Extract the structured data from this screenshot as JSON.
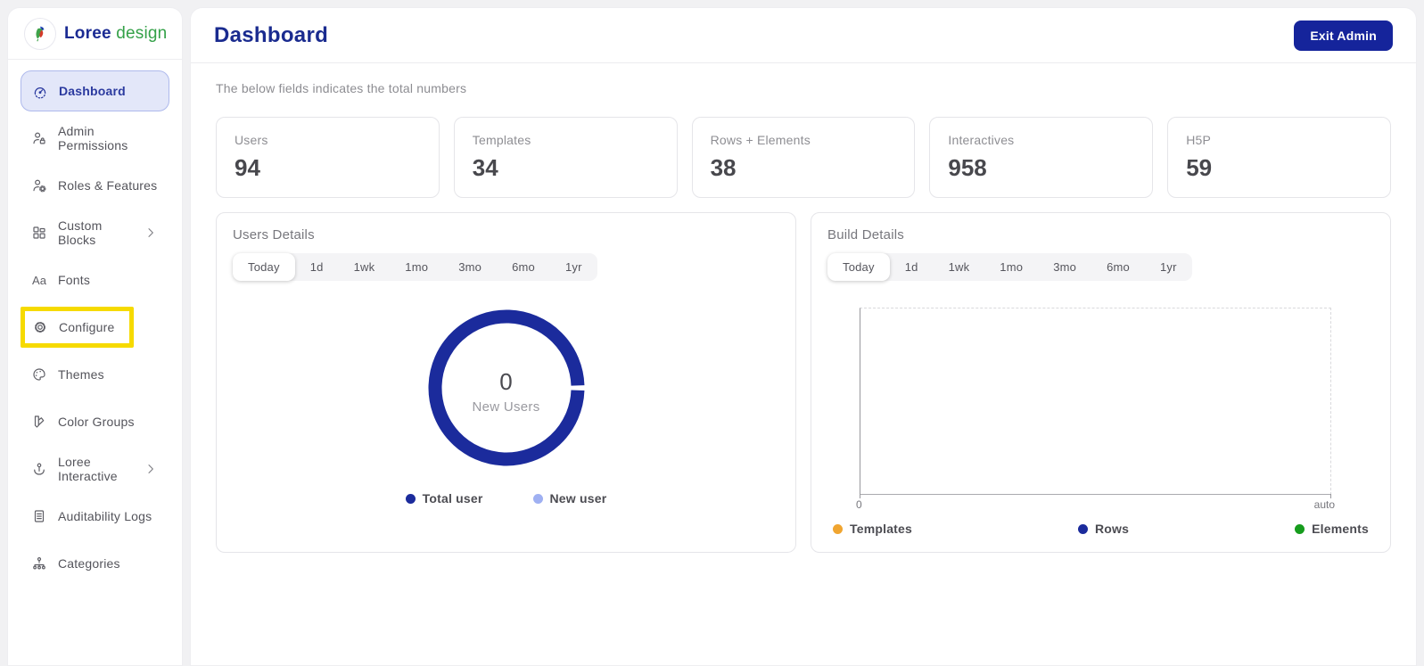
{
  "brand": {
    "logo_icon": "parrot-icon",
    "name_primary": "Loree",
    "name_secondary": "design"
  },
  "header": {
    "title": "Dashboard",
    "exit_button_label": "Exit Admin",
    "subtitle": "The below fields indicates the total numbers"
  },
  "sidebar": {
    "items": [
      {
        "label": "Dashboard",
        "icon": "gauge-icon",
        "active": true
      },
      {
        "label": "Admin Permissions",
        "icon": "user-lock-icon"
      },
      {
        "label": "Roles & Features",
        "icon": "user-gear-icon"
      },
      {
        "label": "Custom Blocks",
        "icon": "blocks-icon",
        "has_submenu": true
      },
      {
        "label": "Fonts",
        "icon": "fonts-icon"
      },
      {
        "label": "Configure",
        "icon": "gear-icon",
        "highlighted": true
      },
      {
        "label": "Themes",
        "icon": "palette-icon"
      },
      {
        "label": "Color Groups",
        "icon": "swatches-icon"
      },
      {
        "label": "Loree Interactive",
        "icon": "interactive-icon",
        "has_submenu": true
      },
      {
        "label": "Auditability Logs",
        "icon": "logs-icon"
      },
      {
        "label": "Categories",
        "icon": "categories-icon"
      }
    ]
  },
  "stats": [
    {
      "label": "Users",
      "value": "94"
    },
    {
      "label": "Templates",
      "value": "34"
    },
    {
      "label": "Rows + Elements",
      "value": "38"
    },
    {
      "label": "Interactives",
      "value": "958"
    },
    {
      "label": "H5P",
      "value": "59"
    }
  ],
  "users_details": {
    "title": "Users Details",
    "tabs": [
      "Today",
      "1d",
      "1wk",
      "1mo",
      "3mo",
      "6mo",
      "1yr"
    ],
    "active_tab": "Today",
    "chart_data": {
      "type": "pie",
      "style": "donut",
      "center_value": "0",
      "center_label": "New Users",
      "segments": [
        {
          "label": "Total user",
          "color": "#1b2b9c",
          "fraction": 0.99
        },
        {
          "label": "New user",
          "color": "#9fb0f2",
          "fraction": 0.01
        }
      ]
    },
    "legend": [
      {
        "label": "Total user",
        "color": "#1b2b9c"
      },
      {
        "label": "New user",
        "color": "#9fb0f2"
      }
    ]
  },
  "build_details": {
    "title": "Build Details",
    "tabs": [
      "Today",
      "1d",
      "1wk",
      "1mo",
      "3mo",
      "6mo",
      "1yr"
    ],
    "active_tab": "Today",
    "chart_data": {
      "type": "line",
      "empty": true,
      "x_axis_ticks": [
        "0",
        "auto"
      ],
      "grid": "dashed-frame",
      "legend_position": "bottom-spread",
      "series": [
        {
          "name": "Templates",
          "color": "#f0a530",
          "values": []
        },
        {
          "name": "Rows",
          "color": "#1b2b9c",
          "values": []
        },
        {
          "name": "Elements",
          "color": "#169c1d",
          "values": []
        }
      ]
    },
    "legend": [
      {
        "label": "Templates",
        "color": "#f0a530"
      },
      {
        "label": "Rows",
        "color": "#1b2b9c"
      },
      {
        "label": "Elements",
        "color": "#169c1d"
      }
    ]
  },
  "colors": {
    "accent_blue": "#1b2b9c",
    "brand_green": "#34a148",
    "highlight_yellow": "#f6da00",
    "active_item_bg": "#e3e7f9",
    "page_bg": "#f1f1f3"
  }
}
